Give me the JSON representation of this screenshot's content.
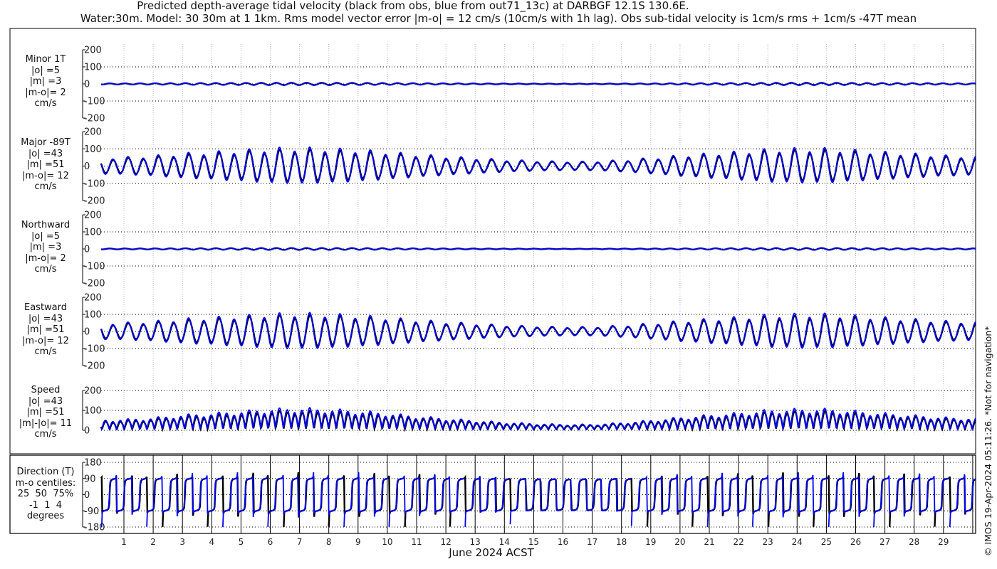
{
  "title_line1": "Predicted depth-average tidal velocity (black from obs, blue from out71_13c) at DARBGF 12.1S 130.6E.",
  "title_line2": "Water:30m. Model: 30 30m at 1 1km. Rms model vector error |m-o| = 12 cm/s (10cm/s with 1h lag). Obs sub-tidal velocity is 1cm/s rms + 1cm/s -47T mean",
  "credit": "© IMOS 19-Apr-2024 05:11:26. *Not for navigation*",
  "colors": {
    "obs": "#000000",
    "model": "#0000ff",
    "grid": "#000000",
    "vgrid": "#b0b8d8"
  },
  "chart_data": {
    "type": "line",
    "xlabel": "June 2024 ACST",
    "x_ticks": [
      "1",
      "2",
      "3",
      "4",
      "5",
      "6",
      "7",
      "8",
      "9",
      "10",
      "11",
      "12",
      "13",
      "14",
      "15",
      "16",
      "17",
      "18",
      "19",
      "20",
      "21",
      "22",
      "23",
      "24",
      "25",
      "26",
      "27",
      "28",
      "29"
    ],
    "xlim_days": [
      0.22,
      30.1
    ],
    "tidal_period_hours": 12.42,
    "major_amplitude_by_day": [
      48,
      50,
      58,
      72,
      80,
      90,
      100,
      105,
      100,
      92,
      80,
      66,
      55,
      45,
      36,
      30,
      26,
      26,
      34,
      46,
      60,
      72,
      82,
      95,
      100,
      100,
      90,
      80,
      70,
      60,
      55
    ],
    "panels": [
      {
        "name": "minor",
        "labels": [
          "Minor 1T",
          "|o| =5",
          "|m| =3",
          "|m-o|= 2",
          "cm/s"
        ],
        "yticks": [
          "200",
          "100",
          "0",
          "-100",
          "-200"
        ],
        "ylim": [
          -200,
          200
        ],
        "amplitude_scale": 0.06
      },
      {
        "name": "major",
        "labels": [
          "Major -89T",
          "|o| =43",
          "|m| =51",
          "|m-o|= 12",
          "cm/s"
        ],
        "yticks": [
          "200",
          "100",
          "0",
          "-100",
          "-200"
        ],
        "ylim": [
          -200,
          200
        ],
        "amplitude_scale": 1
      },
      {
        "name": "northward",
        "labels": [
          "Northward",
          "|o| =5",
          "|m| =3",
          "|m-o|= 2",
          "cm/s"
        ],
        "yticks": [
          "200",
          "100",
          "0",
          "-100",
          "-200"
        ],
        "ylim": [
          -200,
          200
        ],
        "amplitude_scale": 0.05
      },
      {
        "name": "eastward",
        "labels": [
          "Eastward",
          "|o| =43",
          "|m| =51",
          "|m-o|= 12",
          "cm/s"
        ],
        "yticks": [
          "200",
          "100",
          "0",
          "-100",
          "-200"
        ],
        "ylim": [
          -200,
          200
        ],
        "amplitude_scale": 1
      },
      {
        "name": "speed",
        "labels": [
          "Speed",
          "|o| =43",
          "|m| =51",
          "|m|-|o|= 11",
          "cm/s"
        ],
        "yticks": [
          "200",
          "100",
          "0"
        ],
        "ylim": [
          0,
          200
        ],
        "amplitude_scale": 1
      },
      {
        "name": "direction",
        "labels": [
          "Direction (T)",
          "m-o centiles:",
          "25  50  75%",
          "-1  1  4",
          "degrees"
        ],
        "yticks": [
          "180",
          "90",
          "0",
          "-90",
          "-180"
        ],
        "ylim": [
          -180,
          180
        ],
        "amplitude_scale": 1
      }
    ]
  }
}
